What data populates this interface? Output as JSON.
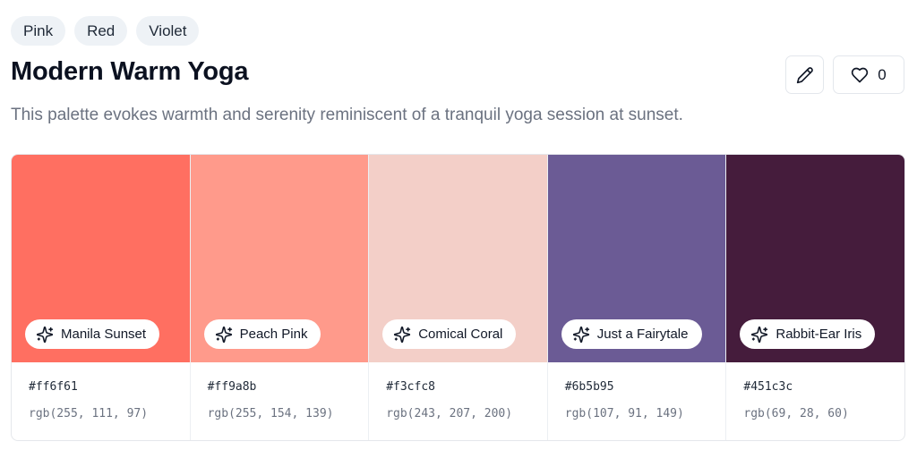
{
  "tags": [
    "Pink",
    "Red",
    "Violet"
  ],
  "title": "Modern Warm Yoga",
  "description": "This palette evokes warmth and serenity reminiscent of a tranquil yoga session at sunset.",
  "actions": {
    "edit_icon": "pencil-icon",
    "like_icon": "heart-icon",
    "like_count": "0"
  },
  "colors": [
    {
      "name": "Manila Sunset",
      "hex": "#ff6f61",
      "rgb": "rgb(255, 111, 97)",
      "icon": "sparkles-icon"
    },
    {
      "name": "Peach Pink",
      "hex": "#ff9a8b",
      "rgb": "rgb(255, 154, 139)",
      "icon": "sparkles-icon"
    },
    {
      "name": "Comical Coral",
      "hex": "#f3cfc8",
      "rgb": "rgb(243, 207, 200)",
      "icon": "sparkles-icon"
    },
    {
      "name": "Just a Fairytale",
      "hex": "#6b5b95",
      "rgb": "rgb(107, 91, 149)",
      "icon": "sparkles-icon"
    },
    {
      "name": "Rabbit-Ear Iris",
      "hex": "#451c3c",
      "rgb": "rgb(69, 28, 60)",
      "icon": "sparkles-icon"
    }
  ]
}
